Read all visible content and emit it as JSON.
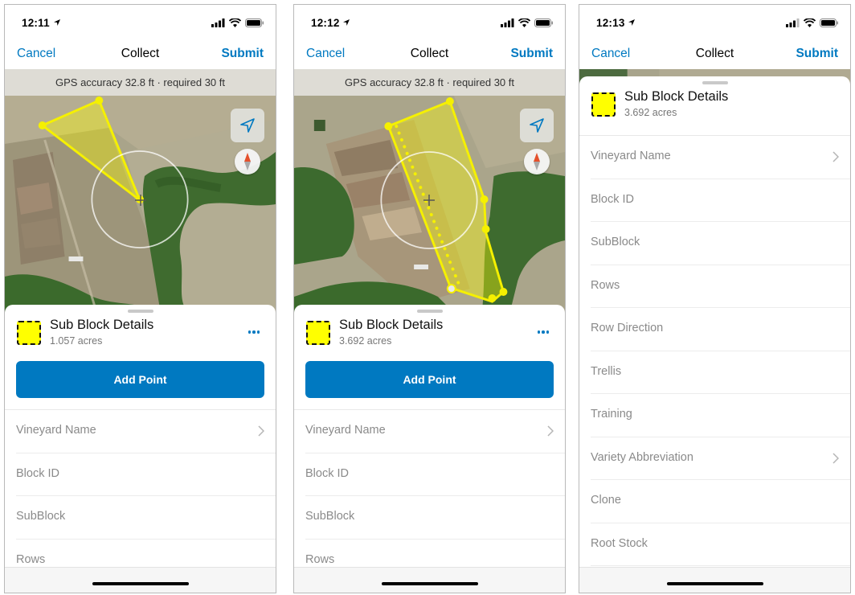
{
  "screens": [
    {
      "status": {
        "time": "12:11"
      },
      "nav": {
        "cancel": "Cancel",
        "title": "Collect",
        "submit": "Submit"
      },
      "gps_banner": "GPS accuracy 32.8 ft · required 30 ft",
      "sheet": {
        "title": "Sub Block Details",
        "area": "1.057 acres",
        "add_point": "Add Point",
        "fields": [
          {
            "label": "Vineyard Name",
            "chevron": true
          },
          {
            "label": "Block ID",
            "chevron": false
          },
          {
            "label": "SubBlock",
            "chevron": false
          },
          {
            "label": "Rows",
            "chevron": false
          }
        ]
      }
    },
    {
      "status": {
        "time": "12:12"
      },
      "nav": {
        "cancel": "Cancel",
        "title": "Collect",
        "submit": "Submit"
      },
      "gps_banner": "GPS accuracy 32.8 ft · required 30 ft",
      "sheet": {
        "title": "Sub Block Details",
        "area": "3.692 acres",
        "add_point": "Add Point",
        "fields": [
          {
            "label": "Vineyard Name",
            "chevron": true
          },
          {
            "label": "Block ID",
            "chevron": false
          },
          {
            "label": "SubBlock",
            "chevron": false
          },
          {
            "label": "Rows",
            "chevron": false
          }
        ]
      }
    },
    {
      "status": {
        "time": "12:13"
      },
      "nav": {
        "cancel": "Cancel",
        "title": "Collect",
        "submit": "Submit"
      },
      "sheet": {
        "title": "Sub Block Details",
        "area": "3.692 acres",
        "fields": [
          {
            "label": "Vineyard Name",
            "chevron": true
          },
          {
            "label": "Block ID",
            "chevron": false
          },
          {
            "label": "SubBlock",
            "chevron": false
          },
          {
            "label": "Rows",
            "chevron": false
          },
          {
            "label": "Row Direction",
            "chevron": false
          },
          {
            "label": "Trellis",
            "chevron": false
          },
          {
            "label": "Training",
            "chevron": false
          },
          {
            "label": "Variety Abbreviation",
            "chevron": true
          },
          {
            "label": "Clone",
            "chevron": false
          },
          {
            "label": "Root Stock",
            "chevron": false
          }
        ]
      }
    }
  ],
  "icons": {
    "location": "navigation-arrow-icon",
    "compass": "compass-icon",
    "more": "ellipsis-icon",
    "chevron": "chevron-right-icon"
  },
  "colors": {
    "accent": "#0079c1",
    "polygon_fill": "#ffff00",
    "polygon_stroke": "#f5f000"
  }
}
